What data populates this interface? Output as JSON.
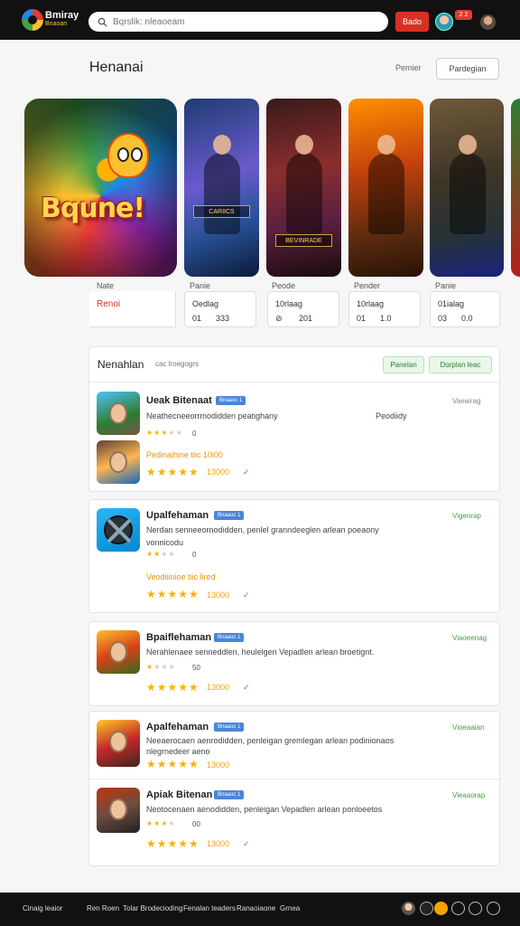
{
  "topbar": {
    "logo_title": "Bmiray",
    "logo_subtitle": "Bnaoan",
    "search_placeholder": "Bqrslik: nleaoeam",
    "action_button": "Bado",
    "badge": "2 2"
  },
  "header": {
    "title": "Henanai",
    "link": "Pemier",
    "button": "Pardegian"
  },
  "carousel": {
    "big_title": "Bqune!",
    "labels": [
      "CARIICS",
      "BEVINRADE"
    ]
  },
  "info": {
    "captions": [
      "Nate",
      "Panie",
      "Peode",
      "Pender",
      "Panie"
    ],
    "first_value": "Renoi",
    "cards": [
      {
        "v1": "Oedlag",
        "v2": "01",
        "v2b": "333"
      },
      {
        "v1": "10rlaag",
        "v2": "⊘",
        "v2b": "201"
      },
      {
        "v1": "10rlaag",
        "v2": "01",
        "v2b": "1.0"
      },
      {
        "v1": "01ialag",
        "v2": "03",
        "v2b": "0.0"
      }
    ]
  },
  "list_section": {
    "title": "Nenahlan",
    "subtitle": "cac lroegogrs",
    "btn_left": "Panelan",
    "btn_right": "Dorplan leac"
  },
  "apps": [
    {
      "name": "Ueak Bitenaat",
      "tag": "Bnaaoc 1",
      "desc": "Neathecneeorrmodidden peatighany",
      "right_text": "Peodiidy",
      "link": "Vaeairag",
      "mini_rating": "0",
      "sub_text": "Pedinaihine tiic 10i00",
      "rating": "13000",
      "check": "✓"
    },
    {
      "name": "Upalfehaman",
      "tag": "Bnaaoc 1",
      "desc": "Nerdan senneeornodidden, penlel granndeeglen arlean poeaony",
      "desc2": "vonnicodu",
      "link": "Vigenrap",
      "mini_rating": "0",
      "sub_text": "Veodiiinioe tiic lired",
      "rating": "13000",
      "check": "✓"
    },
    {
      "name": "Bpaiflehaman",
      "tag": "Bnaaoc 1",
      "desc": "Nerahlenaee senneddlen, heulelgen Vepadlen arlean broetignt.",
      "link": "Viaoeenag",
      "mini_rating": "50",
      "rating": "13000",
      "check": "✓"
    },
    {
      "name": "Apalfehaman",
      "tag": "Bnaaoc 1",
      "desc": "Neeaerocaen aenrodidden, penleigan gremlegan arlean podinionaos",
      "desc2": "nlegrnedeer aeno",
      "link": "Vioeaaian",
      "rating": "13000"
    },
    {
      "name": "Apiak Bitenan",
      "tag": "Bnaaoc 1",
      "desc": "Neotocenaen aenodidden, penleigan Vepadlen arlean ponloeetos",
      "link": "Vieaaorap",
      "mini_rating": "00",
      "rating": "13000",
      "check": "✓"
    }
  ],
  "footer": {
    "links": [
      "Cinaig leaior",
      "Ren Roen",
      "Tolar Brodecioding",
      "Fenalan teaders",
      "Ranaoiaone",
      "Grnea"
    ]
  },
  "colors": {
    "accent_red": "#d93025",
    "accent_green": "#43a047",
    "star": "#f5b400",
    "tag_blue": "#4a86d8"
  }
}
